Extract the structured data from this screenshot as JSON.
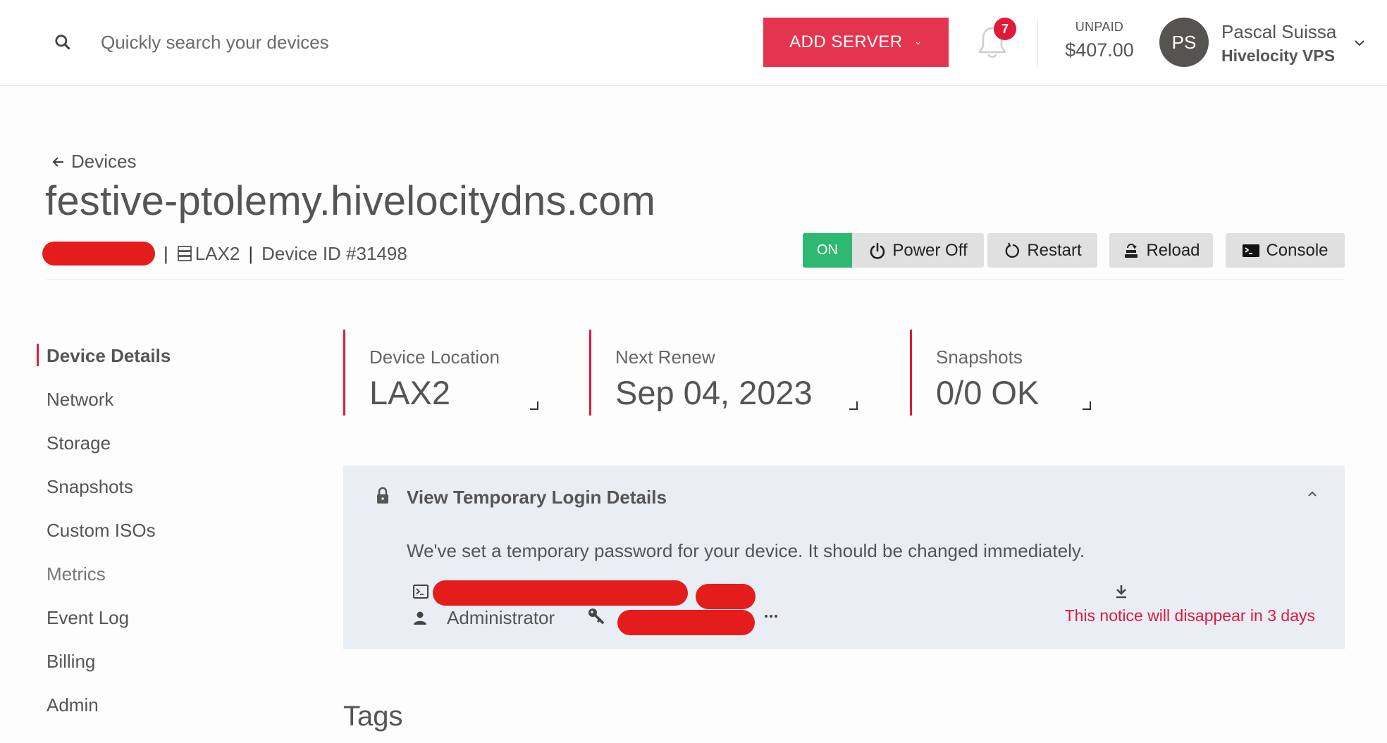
{
  "header": {
    "search_placeholder": "Quickly search your devices",
    "add_server_label": "ADD SERVER",
    "notifications_count": "7",
    "unpaid_label": "UNPAID",
    "unpaid_amount": "$407.00",
    "user": {
      "initials": "PS",
      "name": "Pascal Suissa",
      "org": "Hivelocity VPS"
    }
  },
  "breadcrumb": {
    "back_label": "Devices"
  },
  "device": {
    "hostname": "festive-ptolemy.hivelocitydns.com",
    "location": "LAX2",
    "device_id": "Device ID #31498",
    "power_state": "ON"
  },
  "actions": {
    "power_off": "Power Off",
    "restart": "Restart",
    "reload": "Reload",
    "console": "Console"
  },
  "sidebar": {
    "items": [
      {
        "label": "Device Details",
        "active": true
      },
      {
        "label": "Network"
      },
      {
        "label": "Storage"
      },
      {
        "label": "Snapshots"
      },
      {
        "label": "Custom ISOs"
      },
      {
        "label": "Metrics"
      },
      {
        "label": "Event Log"
      },
      {
        "label": "Billing"
      },
      {
        "label": "Admin"
      }
    ]
  },
  "stats": [
    {
      "label": "Device Location",
      "value": "LAX2"
    },
    {
      "label": "Next Renew",
      "value": "Sep 04, 2023"
    },
    {
      "label": "Snapshots",
      "value": "0/0 OK"
    }
  ],
  "login_panel": {
    "title": "View Temporary Login Details",
    "description": "We've set a temporary password for your device. It should be changed immediately.",
    "username": "Administrator",
    "notice": "This notice will disappear in 3 days"
  },
  "tags": {
    "heading": "Tags"
  },
  "colors": {
    "accent": "#e5344f",
    "on_status": "#2eb872",
    "redaction": "#e51c1c",
    "panel_bg": "#e9eef5"
  }
}
